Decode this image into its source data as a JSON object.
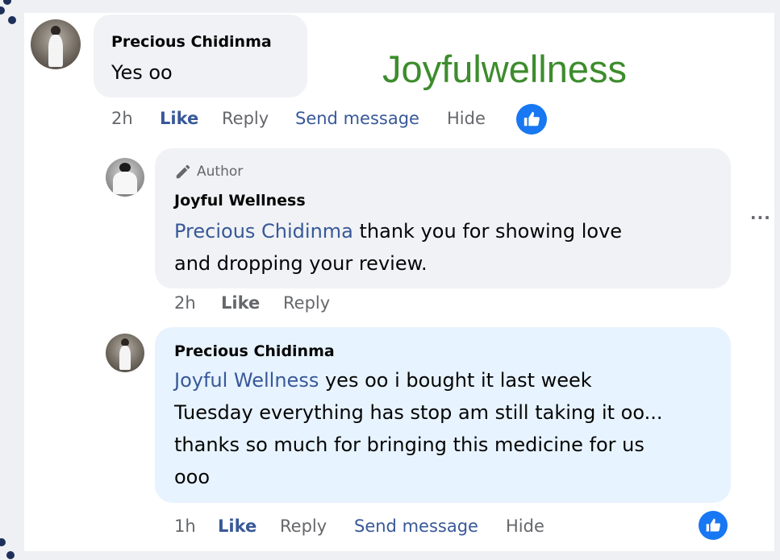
{
  "watermark": "Joyfulwellness",
  "comment1": {
    "author": "Precious Chidinma",
    "text": "Yes oo",
    "time": "2h",
    "actions": {
      "like": "Like",
      "reply": "Reply",
      "send_message": "Send message",
      "hide": "Hide"
    }
  },
  "reply1": {
    "badge": "Author",
    "author": "Joyful Wellness",
    "mention": "Precious Chidinma",
    "text_line1": " thank you for showing love",
    "text_line2": "and dropping your review.",
    "time": "2h",
    "actions": {
      "like": "Like",
      "reply": "Reply"
    },
    "more": "···"
  },
  "reply2": {
    "author": "Precious Chidinma",
    "mention": "Joyful Wellness",
    "text_line1": " yes oo i bought it last week",
    "text_line2": "Tuesday everything has stop am still taking it oo...",
    "text_line3": "thanks so much for bringing this medicine for us",
    "text_line4": "ooo",
    "time": "1h",
    "actions": {
      "like": "Like",
      "reply": "Reply",
      "send_message": "Send message",
      "hide": "Hide"
    }
  },
  "colors": {
    "bubble": "#f0f2f5",
    "bubble_highlight": "#e7f3ff",
    "link": "#385898",
    "like_blue": "#1877f2",
    "watermark": "#3d8c2d"
  }
}
